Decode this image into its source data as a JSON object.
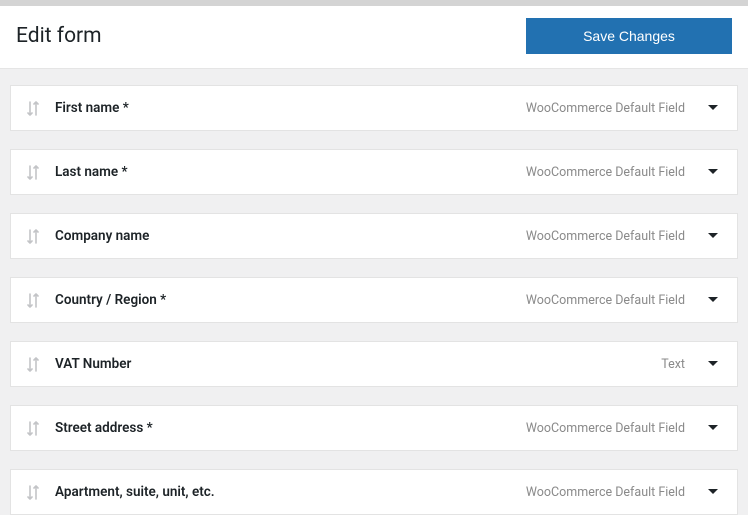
{
  "header": {
    "title": "Edit form",
    "save_label": "Save Changes"
  },
  "fields": [
    {
      "label": "First name *",
      "type_label": "WooCommerce Default Field"
    },
    {
      "label": "Last name *",
      "type_label": "WooCommerce Default Field"
    },
    {
      "label": "Company name",
      "type_label": "WooCommerce Default Field"
    },
    {
      "label": "Country / Region *",
      "type_label": "WooCommerce Default Field"
    },
    {
      "label": "VAT Number",
      "type_label": "Text"
    },
    {
      "label": "Street address *",
      "type_label": "WooCommerce Default Field"
    },
    {
      "label": "Apartment, suite, unit, etc.",
      "type_label": "WooCommerce Default Field"
    }
  ]
}
